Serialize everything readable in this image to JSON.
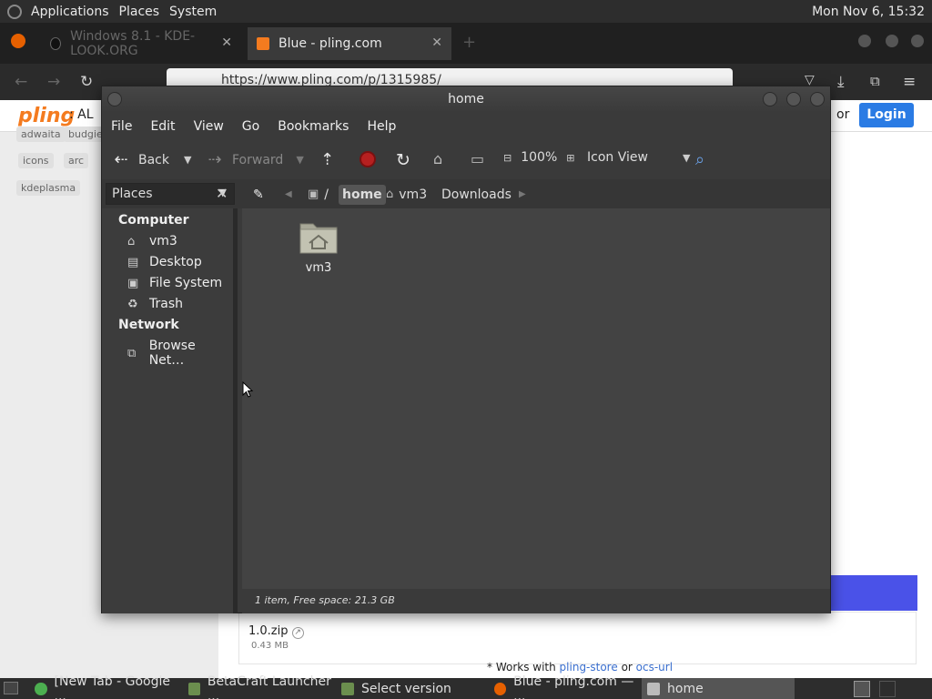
{
  "top_panel": {
    "menus": [
      "Applications",
      "Places",
      "System"
    ],
    "clock": "Mon Nov 6, 15:32"
  },
  "firefox": {
    "tabs": [
      {
        "label": "Windows 8.1 - KDE-LOOK.ORG",
        "active": false
      },
      {
        "label": "Blue - pling.com",
        "active": true
      }
    ],
    "url": "https://www.pling.com/p/1315985/",
    "page": {
      "logo": "pling",
      "logo_suffix": ": AL",
      "or_text": "or",
      "login": "Login",
      "tags": [
        "adwaita",
        "budgie",
        "icons",
        "arc",
        "kdeplasma"
      ],
      "download_name": "1.0.zip",
      "download_size": "0.43 MB",
      "works_with_prefix": "* Works with ",
      "works_with_link1": "pling-store",
      "works_with_or": " or ",
      "works_with_link2": "ocs-url"
    }
  },
  "caja": {
    "title": "home",
    "menu": [
      "File",
      "Edit",
      "View",
      "Go",
      "Bookmarks",
      "Help"
    ],
    "toolbar": {
      "back": "Back",
      "forward": "Forward",
      "zoom": "100%",
      "view_mode": "Icon View"
    },
    "places_label": "Places",
    "path": {
      "root": "/",
      "crumbs": [
        "home",
        "vm3",
        "Downloads"
      ],
      "active": "home"
    },
    "sidebar": {
      "computer_heading": "Computer",
      "computer_items": [
        "vm3",
        "Desktop",
        "File System",
        "Trash"
      ],
      "network_heading": "Network",
      "network_items": [
        "Browse Net…"
      ]
    },
    "items": [
      {
        "name": "vm3",
        "type": "home-folder"
      }
    ],
    "status": "1 item, Free space: 21.3 GB"
  },
  "taskbar": {
    "tasks": [
      {
        "label": "[New Tab - Google ...",
        "active": false
      },
      {
        "label": "BetaCraft Launcher ...",
        "active": false
      },
      {
        "label": "Select version",
        "active": false
      },
      {
        "label": "Blue - pling.com — ...",
        "active": false
      },
      {
        "label": "home",
        "active": true
      }
    ]
  },
  "colors": {
    "panel_bg": "#2d2d2d",
    "caja_bg": "#3a3a3a",
    "content_bg": "#434343",
    "accent_blue": "#2a7be4",
    "pling_orange": "#f47b1f"
  }
}
